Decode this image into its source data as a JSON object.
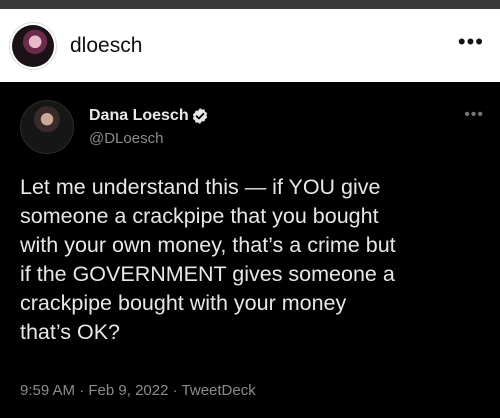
{
  "instagram": {
    "username": "dloesch",
    "more_icon": "more-horizontal-icon"
  },
  "tweet": {
    "display_name": "Dana Loesch",
    "verified_icon": "verified-badge-icon",
    "handle": "@DLoesch",
    "more_icon": "more-horizontal-icon",
    "text": "Let me understand this — if YOU give\nsomeone a crackpipe that you bought\nwith your own money, that’s a crime but\nif the GOVERNMENT gives someone a\ncrackpipe bought with your money\nthat’s OK?",
    "time": "9:59 AM",
    "date": "Feb 9, 2022",
    "source": "TweetDeck",
    "separator": "·"
  }
}
